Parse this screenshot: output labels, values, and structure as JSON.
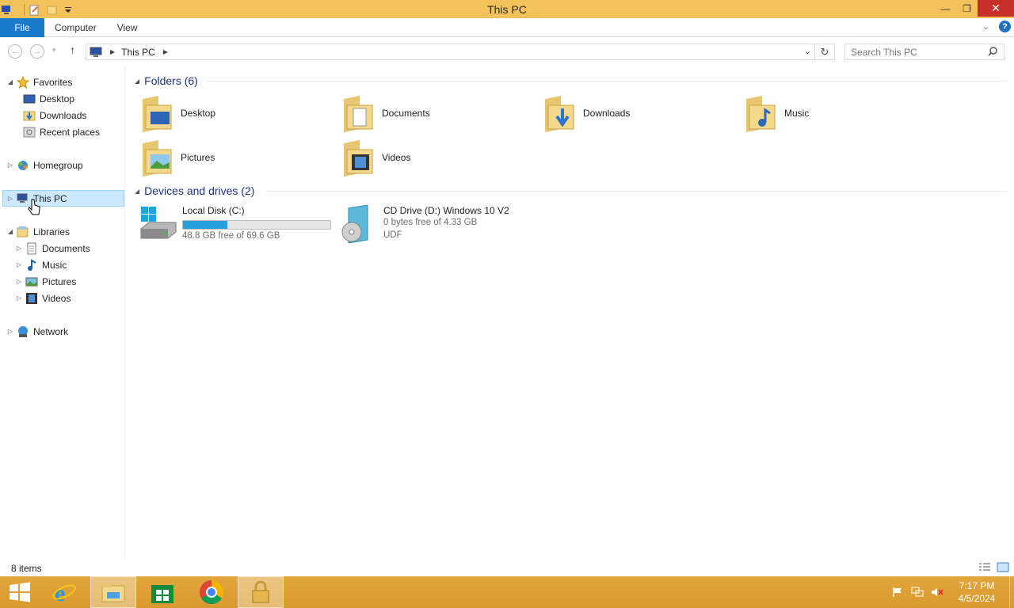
{
  "window": {
    "title": "This PC",
    "minimize": "—",
    "maximize": "❐",
    "close": "✕"
  },
  "ribbon": {
    "tabs": [
      "File",
      "Computer",
      "View"
    ],
    "help": "?"
  },
  "address": {
    "path": "This PC",
    "search_placeholder": "Search This PC"
  },
  "navpane": {
    "favorites": "Favorites",
    "desktop": "Desktop",
    "downloads": "Downloads",
    "recent": "Recent places",
    "homegroup": "Homegroup",
    "thispc": "This PC",
    "libraries": "Libraries",
    "documents": "Documents",
    "music": "Music",
    "pictures": "Pictures",
    "videos": "Videos",
    "network": "Network"
  },
  "content": {
    "folders_header": "Folders (6)",
    "folders": [
      "Desktop",
      "Documents",
      "Downloads",
      "Music",
      "Pictures",
      "Videos"
    ],
    "devices_header": "Devices and drives (2)",
    "drives": [
      {
        "name": "Local Disk (C:)",
        "free": "48.8 GB free of 69.6 GB",
        "used_fraction": 0.3
      },
      {
        "name": "CD Drive (D:) Windows 10 V2",
        "free": "0 bytes free of 4.33 GB",
        "fs": "UDF"
      }
    ]
  },
  "status": {
    "items": "8 items"
  },
  "taskbar": {
    "time": "7:17 PM",
    "date": "4/5/2024"
  },
  "colors": {
    "titlebar": "#f3c25a",
    "taskbar": "#e3a63c",
    "file_tab": "#1979ca",
    "group_title": "#1e3287",
    "drive_bar": "#26a0da"
  }
}
